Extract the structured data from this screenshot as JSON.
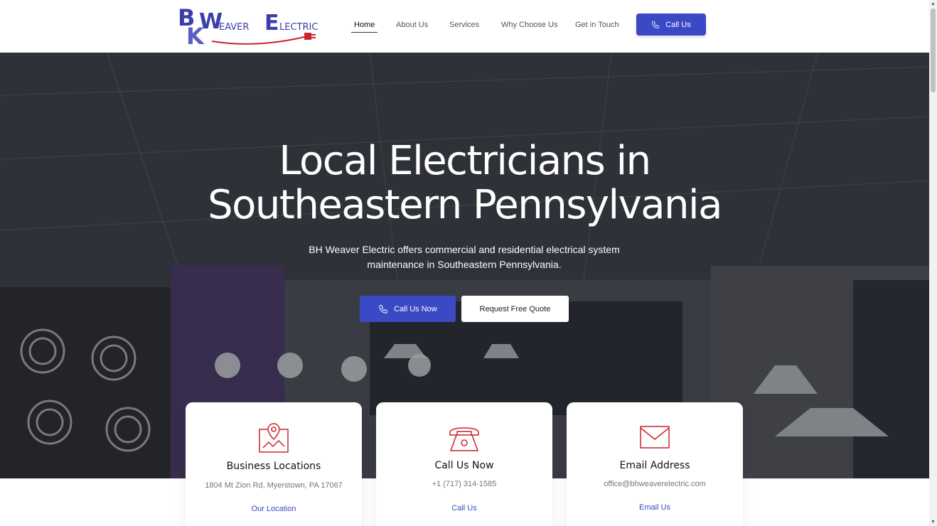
{
  "brand": {
    "logo_initials": "BK",
    "logo_word1": "WEAVER",
    "logo_word2": "ELECTRIC",
    "logo_color": "#3b3fa8",
    "accent_red": "#c9252c"
  },
  "nav": {
    "items": [
      {
        "label": "Home",
        "active": true
      },
      {
        "label": "About Us"
      },
      {
        "label": "Services"
      },
      {
        "label": "Why Choose Us"
      },
      {
        "label": "Get in Touch"
      }
    ],
    "call_button": {
      "label": "Call Us",
      "icon": "phone-icon"
    }
  },
  "hero": {
    "title_line1": "Local Electricians in",
    "title_line2": "Southeastern Pennsylvania",
    "subtitle": "BH Weaver Electric offers commercial and residential electrical system maintenance in Southeastern Pennsylvania.",
    "primary_button": "Call Us Now",
    "secondary_button": "Request Free Quote"
  },
  "cards": [
    {
      "icon": "map-pin-icon",
      "title": "Business Locations",
      "value": "1804 Mt Zion Rd, Myerstown, PA 17067",
      "link": "Our Location"
    },
    {
      "icon": "telephone-icon",
      "title": "Call Us Now",
      "value": "+1 (717) 314-1585",
      "link": "Call Us"
    },
    {
      "icon": "envelope-icon",
      "title": "Email Address",
      "value": "office@bhweaverelectric.com",
      "link": "Email Us"
    }
  ],
  "colors": {
    "primary": "#3b49c4",
    "icon_red": "#c9252c"
  }
}
